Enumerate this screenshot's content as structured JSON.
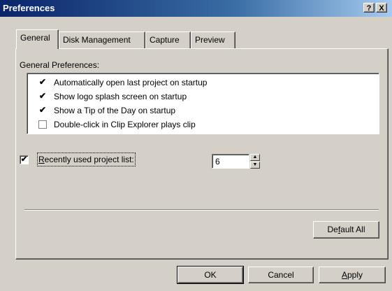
{
  "window": {
    "title": "Preferences",
    "help_glyph": "?",
    "close_glyph": "X"
  },
  "tabs": [
    {
      "label": "General",
      "active": true
    },
    {
      "label": "Disk Management",
      "active": false
    },
    {
      "label": "Capture",
      "active": false
    },
    {
      "label": "Preview",
      "active": false
    }
  ],
  "general": {
    "group_label": "General Preferences:",
    "options": [
      {
        "label": "Automatically open last project on startup",
        "checked": true,
        "mark": "✔"
      },
      {
        "label": "Show logo splash screen on startup",
        "checked": true,
        "mark": "✔"
      },
      {
        "label": "Show a Tip of the Day on startup",
        "checked": true,
        "mark": "✔"
      },
      {
        "label": "Double-click in Clip Explorer plays clip",
        "checked": false,
        "mark": ""
      }
    ],
    "recent_list": {
      "label_underlined": "R",
      "label_rest": "ecently used project list:",
      "checked": true,
      "mark": "✔",
      "count": "6"
    },
    "default_all": {
      "before": "De",
      "underlined": "f",
      "after": "ault All"
    }
  },
  "buttons": {
    "ok": "OK",
    "cancel": "Cancel",
    "apply_underlined": "A",
    "apply_rest": "pply"
  }
}
